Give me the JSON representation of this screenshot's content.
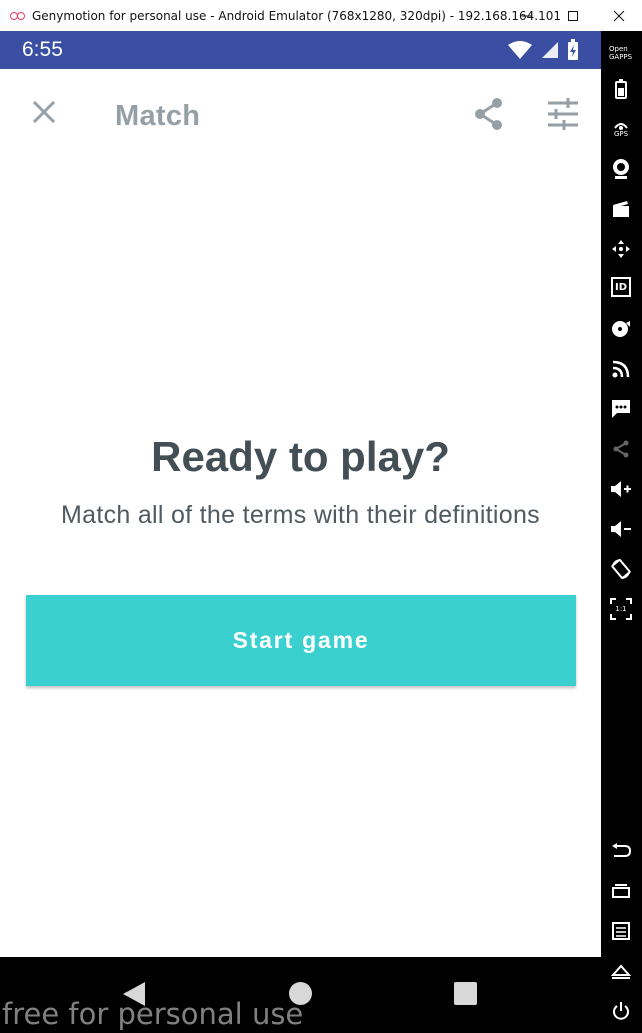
{
  "window": {
    "title": "Genymotion for personal use - Android Emulator (768x1280, 320dpi) - 192.168.164.101",
    "minimize": "—",
    "maximize": "☐",
    "close": "✕"
  },
  "status_bar": {
    "time": "6:55",
    "background": "#3a4fa3"
  },
  "app_bar": {
    "title": "Match",
    "close_icon": "close-icon",
    "share_icon": "share-icon",
    "settings_icon": "tune-icon"
  },
  "content": {
    "headline": "Ready to play?",
    "subtitle": "Match all of the terms with their definitions",
    "start_button": "Start game",
    "accent_color": "#3bd0d0"
  },
  "nav_bar": {
    "back": "back-icon",
    "home": "home-icon",
    "recents": "recents-icon"
  },
  "watermark": "free for personal use",
  "sidebar": {
    "open_gapps_label": "Open GAPPS",
    "gps_label": "GPS",
    "id_label": "ID",
    "pixel_perfect_label": "1:1",
    "items": [
      "open-gapps-icon",
      "battery-icon",
      "gps-icon",
      "camera-icon",
      "media-icon",
      "dpad-icon",
      "identifiers-icon",
      "disk-icon",
      "cast-icon",
      "sms-icon",
      "share-icon",
      "volume-up-icon",
      "volume-down-icon",
      "rotate-icon",
      "pixel-perfect-icon",
      "back-icon",
      "recents-icon",
      "menu-icon",
      "home-icon",
      "power-icon"
    ]
  }
}
